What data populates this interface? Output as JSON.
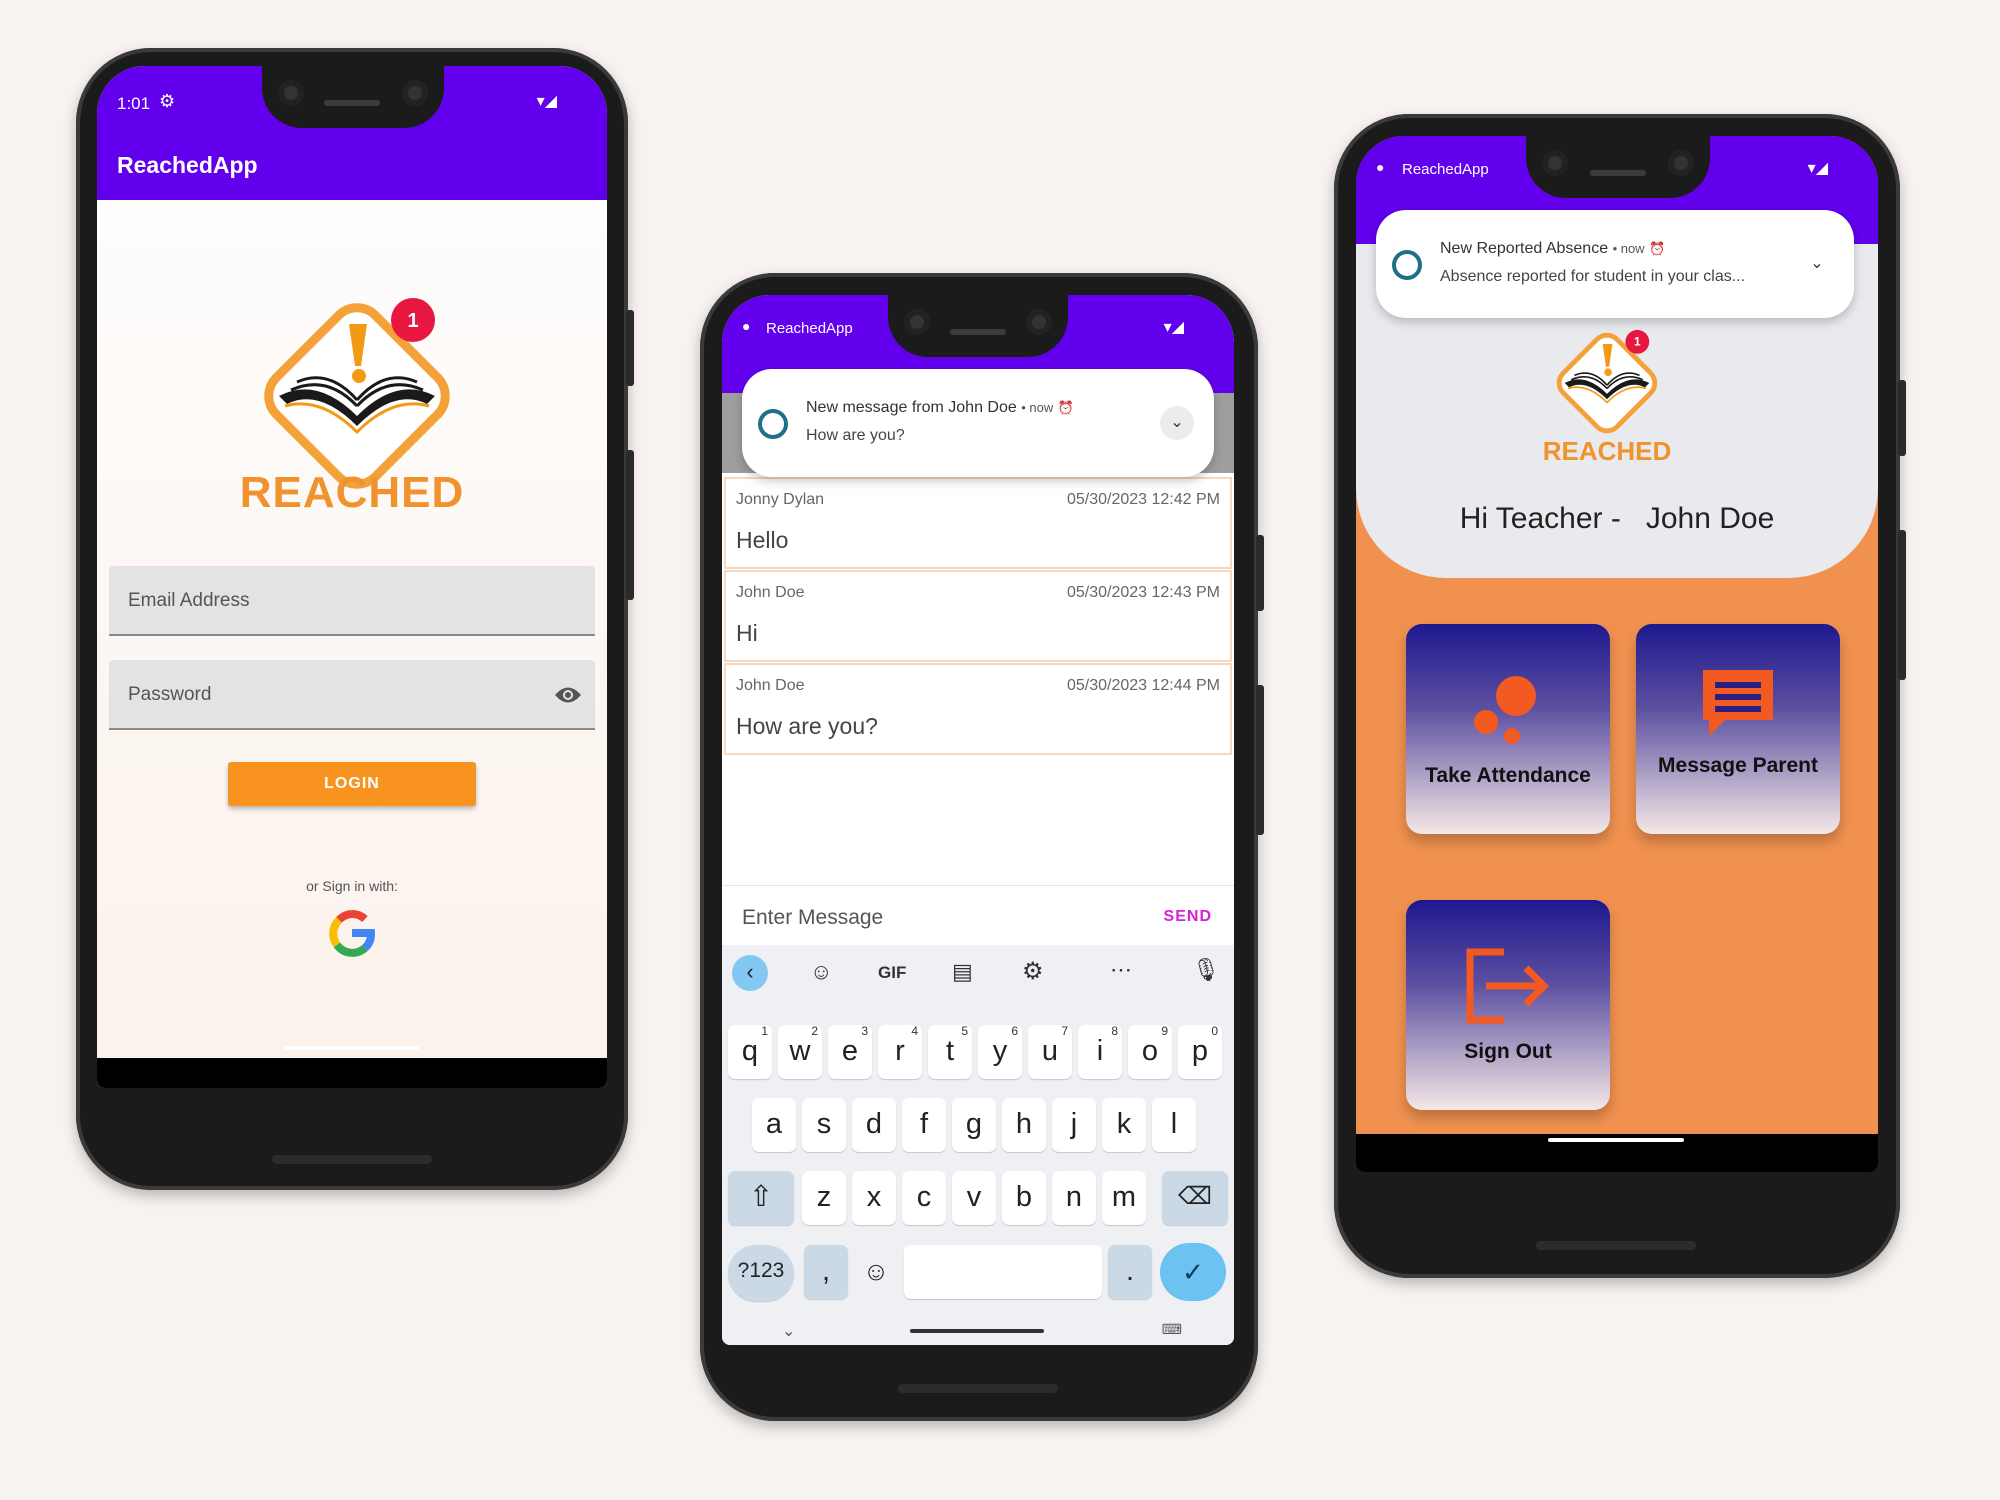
{
  "app_name": "ReachedApp",
  "brand_colors": {
    "primary": "#6200ee",
    "accent": "#f7931e",
    "orange_bg": "#f0914f",
    "badge": "#e8173f"
  },
  "login_screen": {
    "status_time": "1:01",
    "logo_text": "REACHED",
    "badge_count": "1",
    "email_placeholder": "Email Address",
    "password_placeholder": "Password",
    "login_label": "LOGIN",
    "alt_signin_text": "or Sign in with:",
    "google_letter": "G"
  },
  "chat_screen": {
    "notification": {
      "title": "New message from John Doe",
      "when": "• now",
      "body": "How are you?"
    },
    "messages": [
      {
        "from": "Jonny Dylan",
        "time": "05/30/2023 12:42 PM",
        "text": "Hello"
      },
      {
        "from": "John Doe",
        "time": "05/30/2023 12:43 PM",
        "text": "Hi"
      },
      {
        "from": "John Doe",
        "time": "05/30/2023 12:44 PM",
        "text": "How are you?"
      }
    ],
    "input_placeholder": "Enter Message",
    "send_label": "SEND",
    "keyboard": {
      "gif_label": "GIF",
      "row1": [
        {
          "k": "q",
          "n": "1"
        },
        {
          "k": "w",
          "n": "2"
        },
        {
          "k": "e",
          "n": "3"
        },
        {
          "k": "r",
          "n": "4"
        },
        {
          "k": "t",
          "n": "5"
        },
        {
          "k": "y",
          "n": "6"
        },
        {
          "k": "u",
          "n": "7"
        },
        {
          "k": "i",
          "n": "8"
        },
        {
          "k": "o",
          "n": "9"
        },
        {
          "k": "p",
          "n": "0"
        }
      ],
      "row2": [
        "a",
        "s",
        "d",
        "f",
        "g",
        "h",
        "j",
        "k",
        "l"
      ],
      "row3": [
        "z",
        "x",
        "c",
        "v",
        "b",
        "n",
        "m"
      ],
      "symbols_label": "?123",
      "comma_label": ",",
      "period_label": "."
    }
  },
  "home_screen": {
    "notification": {
      "title": "New Reported Absence",
      "when": "• now",
      "body": "Absence reported for student in your clas..."
    },
    "logo_text": "REACHED",
    "badge_count": "1",
    "greeting": "Hi Teacher -   John Doe",
    "tiles": {
      "take_attendance": "Take Attendance",
      "message_parent": "Message Parent",
      "sign_out": "Sign Out"
    }
  }
}
